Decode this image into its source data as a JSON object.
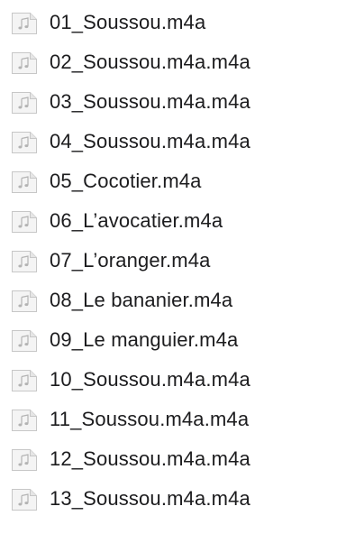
{
  "files": [
    {
      "name": "01_Soussou.m4a",
      "icon": "audio-file-icon"
    },
    {
      "name": "02_Soussou.m4a.m4a",
      "icon": "audio-file-icon"
    },
    {
      "name": "03_Soussou.m4a.m4a",
      "icon": "audio-file-icon"
    },
    {
      "name": "04_Soussou.m4a.m4a",
      "icon": "audio-file-icon"
    },
    {
      "name": "05_Cocotier.m4a",
      "icon": "audio-file-icon"
    },
    {
      "name": "06_L’avocatier.m4a",
      "icon": "audio-file-icon"
    },
    {
      "name": "07_L’oranger.m4a",
      "icon": "audio-file-icon"
    },
    {
      "name": "08_Le bananier.m4a",
      "icon": "audio-file-icon"
    },
    {
      "name": "09_Le manguier.m4a",
      "icon": "audio-file-icon"
    },
    {
      "name": "10_Soussou.m4a.m4a",
      "icon": "audio-file-icon"
    },
    {
      "name": "11_Soussou.m4a.m4a",
      "icon": "audio-file-icon"
    },
    {
      "name": "12_Soussou.m4a.m4a",
      "icon": "audio-file-icon"
    },
    {
      "name": "13_Soussou.m4a.m4a",
      "icon": "audio-file-icon"
    }
  ],
  "colors": {
    "text": "#1c1c1e",
    "icon_border": "#c7c7c7",
    "icon_fill": "#f4f4f4",
    "icon_glyph": "#b3b3b3"
  }
}
